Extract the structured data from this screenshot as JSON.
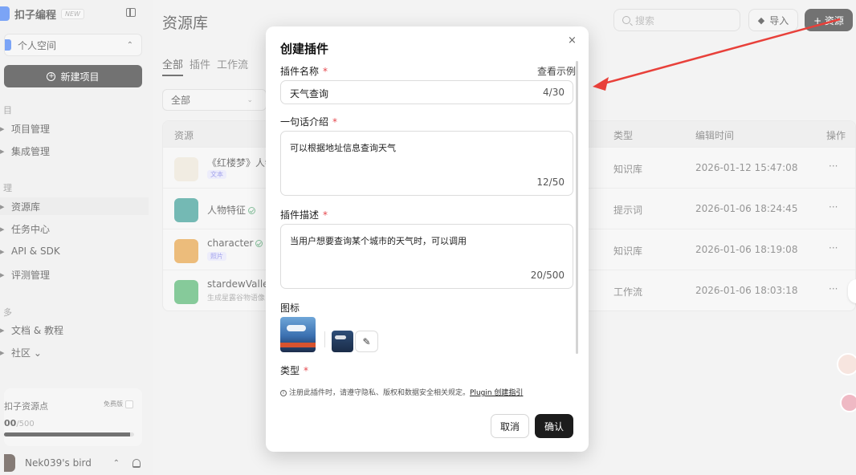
{
  "sidebar": {
    "brand_name": "扣子编程",
    "brand_badge": "NEW",
    "space": "个人空间",
    "new_project": "新建项目",
    "sections": [
      "目",
      "理",
      "多"
    ],
    "items": [
      {
        "icon": "▸",
        "label": "项目管理"
      },
      {
        "icon": "▸",
        "label": "集成管理"
      },
      {
        "icon": "▸",
        "label": "资源库"
      },
      {
        "icon": "▸",
        "label": "任务中心"
      },
      {
        "icon": "▸",
        "label": "API & SDK"
      },
      {
        "icon": "▸",
        "label": "评测管理"
      },
      {
        "icon": "▸",
        "label": "文档 & 教程"
      },
      {
        "icon": "▸",
        "label": "社区 ⌄"
      }
    ],
    "credits": {
      "title": "扣子资源点",
      "plan_badge": "免费版",
      "used": "00",
      "total": "/500",
      "progress_fraction": 0.97
    },
    "user": {
      "name": "Nek039's bird"
    }
  },
  "main": {
    "title": "资源库",
    "search_placeholder": "搜索",
    "import_label": "导入",
    "add_label": "+ 资源",
    "tabs": [
      "全部",
      "插件",
      "工作流"
    ],
    "filter_value": "全部",
    "table": {
      "headers": {
        "resource": "资源",
        "type": "类型",
        "edit_time": "编辑时间",
        "actions": "操作"
      },
      "rows": [
        {
          "title": "《红楼梦》人物",
          "tag": "文本",
          "sub": "",
          "verified": false,
          "type": "知识库",
          "time": "2026-01-12 15:47:08",
          "icon_color": "#e8e0d0"
        },
        {
          "title": "人物特征",
          "tag": "",
          "sub": "",
          "verified": true,
          "type": "提示词",
          "time": "2026-01-06 18:24:45",
          "icon_color": "#1f8f86"
        },
        {
          "title": "character",
          "tag": "照片",
          "sub": "",
          "verified": true,
          "type": "知识库",
          "time": "2026-01-06 18:19:08",
          "icon_color": "#e0932a"
        },
        {
          "title": "stardewValley",
          "tag": "",
          "sub": "生成星露谷物语像",
          "verified": false,
          "type": "工作流",
          "time": "2026-01-06 18:03:18",
          "icon_color": "#3daa5c"
        }
      ],
      "more_label": "···"
    }
  },
  "modal": {
    "title": "创建插件",
    "close": "×",
    "name_label": "插件名称",
    "see_example": "查看示例",
    "name_value": "天气查询",
    "name_count": "4/30",
    "intro_label": "一句话介绍",
    "intro_value": "可以根据地址信息查询天气",
    "intro_count": "12/50",
    "desc_label": "插件描述",
    "desc_value": "当用户想要查询某个城市的天气时，可以调用",
    "desc_count": "20/500",
    "icon_label": "图标",
    "type_label": "类型",
    "required_mark": "*",
    "notice_text": "注册此插件时，请遵守隐私、版权和数据安全相关规定。",
    "notice_link": "Plugin 创建指引",
    "cancel": "取消",
    "confirm": "确认"
  },
  "colors": {
    "accent_dark": "#1c1c1c",
    "required": "#e5484d",
    "annotation_arrow": "#e8403a",
    "verified": "#3c9a5f"
  }
}
